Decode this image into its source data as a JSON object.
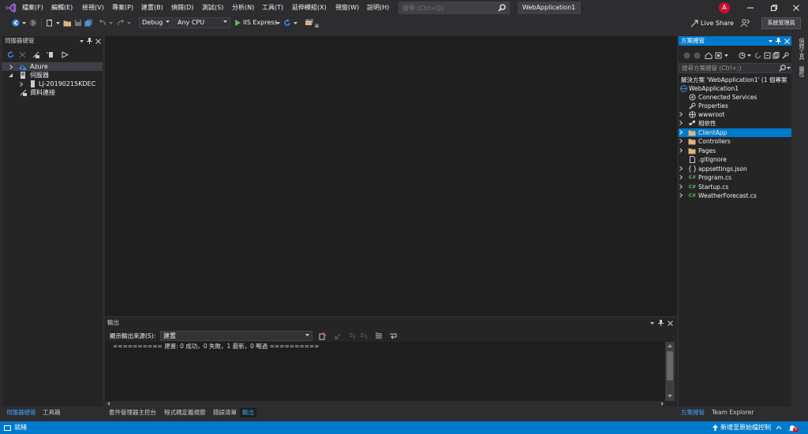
{
  "menu": [
    "檔案(F)",
    "編輯(E)",
    "檢視(V)",
    "專案(P)",
    "建置(B)",
    "偵錯(D)",
    "測試(S)",
    "分析(N)",
    "工具(T)",
    "延伸模組(X)",
    "視窗(W)",
    "說明(H)"
  ],
  "search": {
    "placeholder": "搜尋 (Ctrl+Q)"
  },
  "solution_name": "WebApplication1",
  "user_initial": "A",
  "toolbar": {
    "config": "Debug",
    "platform": "Any CPU",
    "run_target": "IIS Express"
  },
  "live_share": "Live Share",
  "admin_label": "系統管理員",
  "server_explorer": {
    "title": "伺服器總管",
    "items": [
      "Azure",
      "伺服器",
      "LJ-20190215KDEC",
      "資料連接"
    ]
  },
  "output": {
    "title": "輸出",
    "source_label": "顯示輸出來源(S):",
    "source_value": "建置",
    "text": "========== 建置: 0 成功，0 失敗，1 最新，0 略過 =========="
  },
  "solution_explorer": {
    "title": "方案總管",
    "search_placeholder": "搜尋方案總管 (Ctrl+;)",
    "solution_line": "解決方案 'WebApplication1' (1 個專案",
    "project": "WebApplication1",
    "items": [
      "Connected Services",
      "Properties",
      "wwwroot",
      "相依性",
      "ClientApp",
      "Controllers",
      "Pages",
      ".gitignore",
      "appsettings.json",
      "Program.cs",
      "Startup.cs",
      "WeatherForecast.cs"
    ]
  },
  "right_strip": {
    "tab1": "偵錯工具",
    "tab2": "屬性"
  },
  "bottom_tabs": {
    "left": [
      "伺服器總管",
      "工具箱"
    ],
    "center": [
      "套件管理器主控台",
      "程式碼定義視窗",
      "錯誤清單",
      "輸出"
    ],
    "right": [
      "方案總管",
      "Team Explorer"
    ]
  },
  "status": {
    "ready": "就緒",
    "source_control": "新增至原始檔控制",
    "notification_count": "5"
  },
  "colors": {
    "accent": "#007acc",
    "vs_purple": "#865fc5",
    "run_green": "#5cb85c",
    "folder": "#dcb67a",
    "cs": "#5cb85c",
    "user_red": "#c8102e"
  }
}
